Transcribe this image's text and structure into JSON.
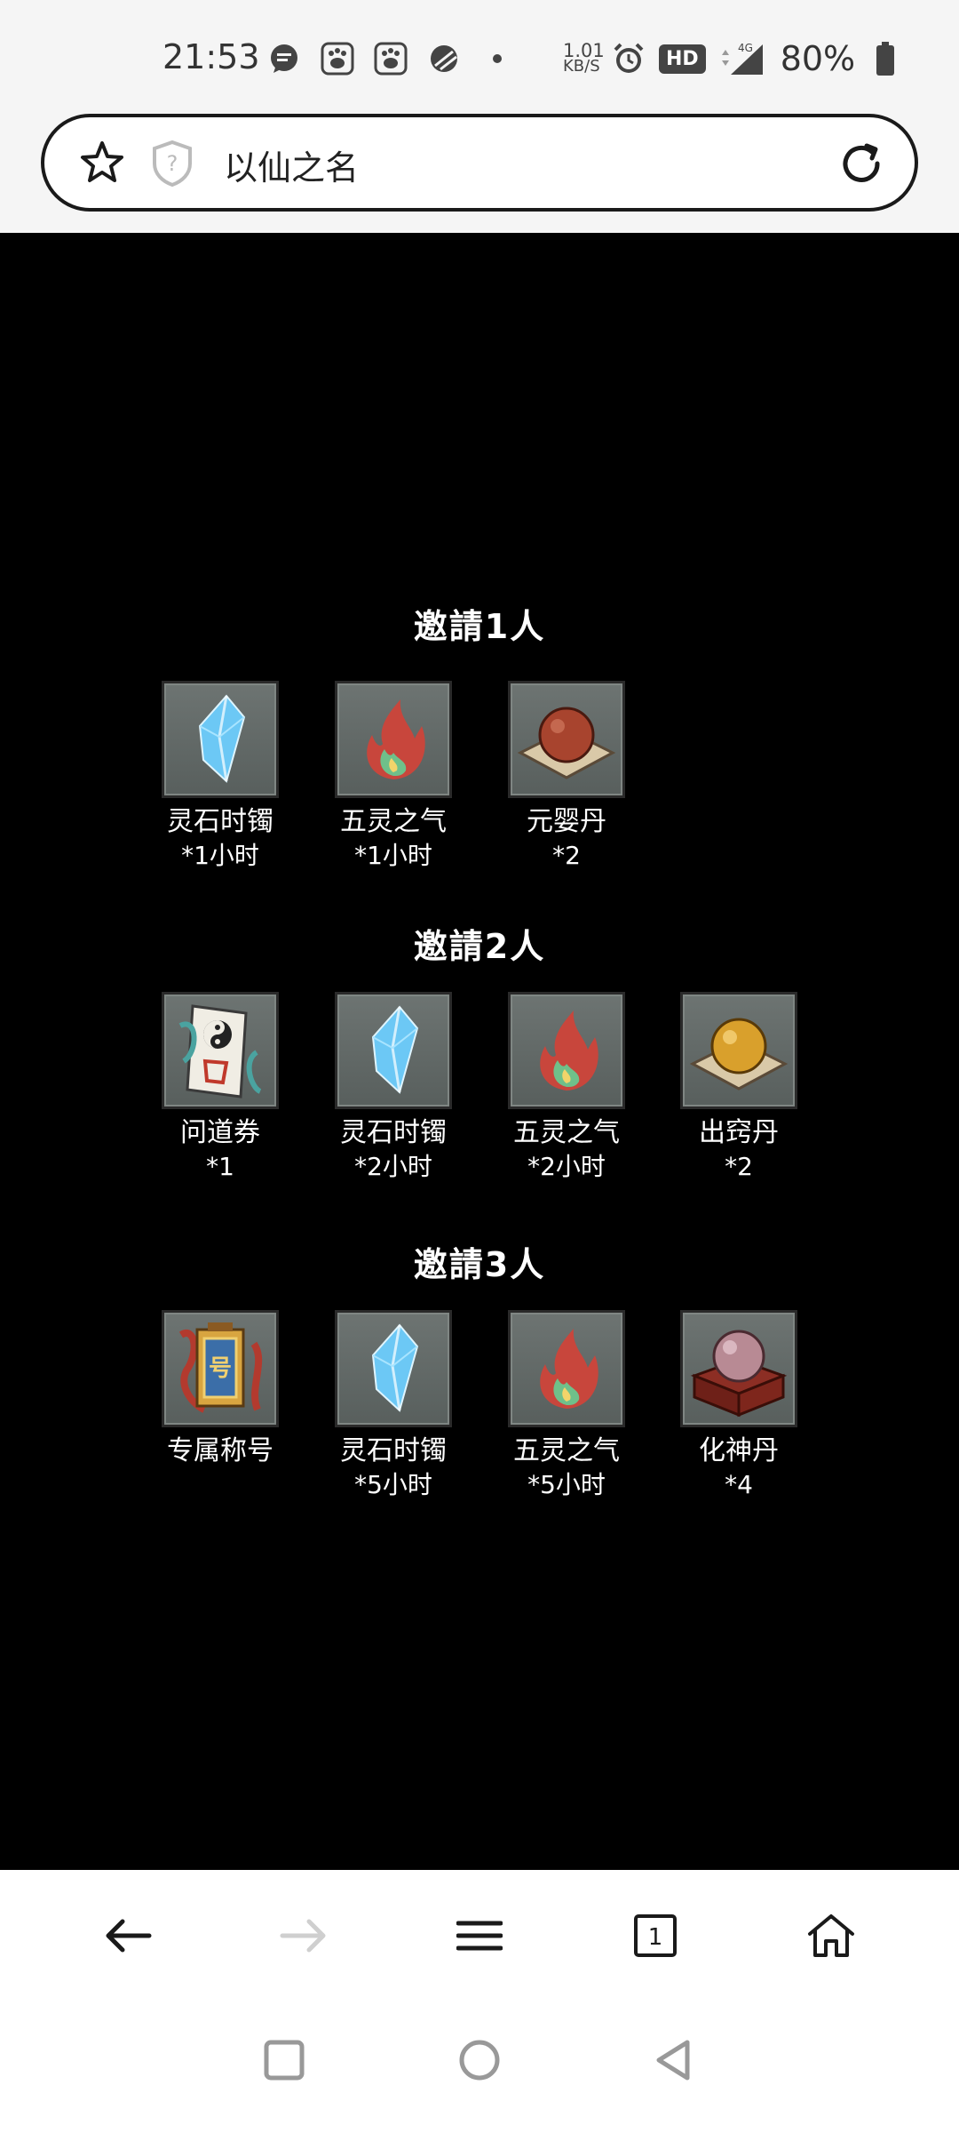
{
  "status_bar": {
    "time": "21:53",
    "net_speed_value": "1.01",
    "net_speed_unit": "KB/S",
    "hd_label": "HD",
    "network_label": "4G",
    "battery_text": "80%"
  },
  "address_bar": {
    "title": "以仙之名"
  },
  "groups": [
    {
      "title": "邀請1人",
      "items": [
        {
          "name": "灵石时镯",
          "qty": "*1小时",
          "icon": "crystal-icon"
        },
        {
          "name": "五灵之气",
          "qty": "*1小时",
          "icon": "five-spirit-flame-icon"
        },
        {
          "name": "元婴丹",
          "qty": "*2",
          "icon": "red-pill-icon"
        }
      ]
    },
    {
      "title": "邀請2人",
      "items": [
        {
          "name": "问道券",
          "qty": "*1",
          "icon": "taoist-ticket-icon"
        },
        {
          "name": "灵石时镯",
          "qty": "*2小时",
          "icon": "crystal-icon"
        },
        {
          "name": "五灵之气",
          "qty": "*2小时",
          "icon": "five-spirit-flame-icon"
        },
        {
          "name": "出窍丹",
          "qty": "*2",
          "icon": "gold-pill-icon"
        }
      ]
    },
    {
      "title": "邀請3人",
      "items": [
        {
          "name": "专属称号",
          "qty": "",
          "icon": "title-plaque-icon"
        },
        {
          "name": "灵石时镯",
          "qty": "*5小时",
          "icon": "crystal-icon"
        },
        {
          "name": "五灵之气",
          "qty": "*5小时",
          "icon": "five-spirit-flame-icon"
        },
        {
          "name": "化神丹",
          "qty": "*4",
          "icon": "purple-pill-box-icon"
        }
      ]
    }
  ],
  "colors": {
    "content_bg": "#000000",
    "tile_bg": "#626967",
    "crystal": "#6cc8f5",
    "flame_red": "#c8463c",
    "flame_green": "#6fc08a"
  }
}
